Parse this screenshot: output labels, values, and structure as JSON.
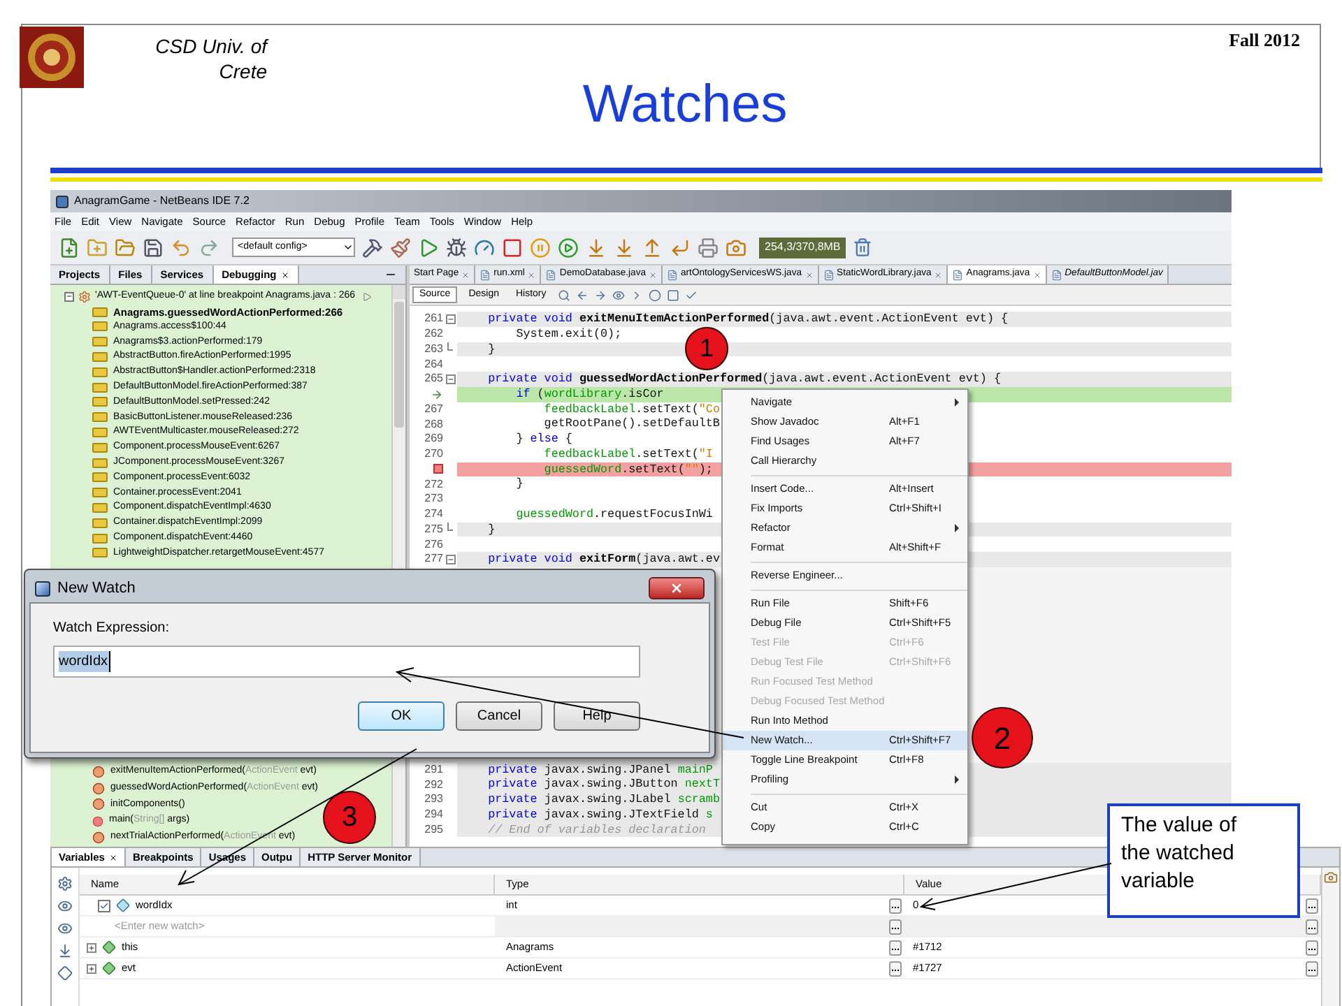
{
  "slide": {
    "institution": "CSD Univ. of Crete",
    "title": "Watches",
    "term": "Fall 2012"
  },
  "window": {
    "title": "AnagramGame - NetBeans IDE 7.2"
  },
  "menu_bar": [
    "File",
    "Edit",
    "View",
    "Navigate",
    "Source",
    "Refactor",
    "Run",
    "Debug",
    "Profile",
    "Team",
    "Tools",
    "Window",
    "Help"
  ],
  "toolbar": {
    "config": "<default config>",
    "memory": "254,3/370,8MB"
  },
  "left_panel": {
    "tabs": [
      {
        "label": "Projects",
        "selected": false
      },
      {
        "label": "Files",
        "selected": false
      },
      {
        "label": "Services",
        "selected": false
      },
      {
        "label": "Debugging",
        "selected": true
      }
    ],
    "thread": {
      "label": "'AWT-EventQueue-0' at line breakpoint Anagrams.java : 266",
      "expanded": true
    },
    "frames": [
      {
        "label": "Anagrams.guessedWordActionPerformed:266",
        "current": true
      },
      {
        "label": "Anagrams.access$100:44",
        "current": false
      },
      {
        "label": "Anagrams$3.actionPerformed:179",
        "current": false
      },
      {
        "label": "AbstractButton.fireActionPerformed:1995",
        "current": false
      },
      {
        "label": "AbstractButton$Handler.actionPerformed:2318",
        "current": false
      },
      {
        "label": "DefaultButtonModel.fireActionPerformed:387",
        "current": false
      },
      {
        "label": "DefaultButtonModel.setPressed:242",
        "current": false
      },
      {
        "label": "BasicButtonListener.mouseReleased:236",
        "current": false
      },
      {
        "label": "AWTEventMulticaster.mouseReleased:272",
        "current": false
      },
      {
        "label": "Component.processMouseEvent:6267",
        "current": false
      },
      {
        "label": "JComponent.processMouseEvent:3267",
        "current": false
      },
      {
        "label": "Component.processEvent:6032",
        "current": false
      },
      {
        "label": "Container.processEvent:2041",
        "current": false
      },
      {
        "label": "Component.dispatchEventImpl:4630",
        "current": false
      },
      {
        "label": "Container.dispatchEventImpl:2099",
        "current": false
      },
      {
        "label": "Component.dispatchEvent:4460",
        "current": false
      },
      {
        "label": "LightweightDispatcher.retargetMouseEvent:4577",
        "current": false
      }
    ],
    "members": [
      {
        "kind": "method",
        "parts": [
          {
            "text": "exitMenuItemActionPerformed("
          },
          {
            "text": "ActionEvent",
            "kind": "type"
          },
          {
            "text": " evt)"
          }
        ]
      },
      {
        "kind": "method",
        "parts": [
          {
            "text": "guessedWordActionPerformed("
          },
          {
            "text": "ActionEvent",
            "kind": "type"
          },
          {
            "text": " evt)"
          }
        ]
      },
      {
        "kind": "method",
        "parts": [
          {
            "text": "initComponents()"
          }
        ]
      },
      {
        "kind": "static",
        "parts": [
          {
            "text": "main("
          },
          {
            "text": "String[]",
            "kind": "type"
          },
          {
            "text": " args)"
          }
        ]
      },
      {
        "kind": "method",
        "parts": [
          {
            "text": "nextTrialActionPerformed("
          },
          {
            "text": "ActionEvent",
            "kind": "type"
          },
          {
            "text": " evt)"
          }
        ]
      }
    ]
  },
  "editor": {
    "tabs": [
      {
        "label": "Start Page",
        "selected": false,
        "italic": false
      },
      {
        "label": "run.xml",
        "selected": false,
        "italic": false
      },
      {
        "label": "DemoDatabase.java",
        "selected": false,
        "italic": false
      },
      {
        "label": "artOntologyServicesWS.java",
        "selected": false,
        "italic": false
      },
      {
        "label": "StaticWordLibrary.java",
        "selected": false,
        "italic": false
      },
      {
        "label": "Anagrams.java",
        "selected": true,
        "italic": false
      },
      {
        "label": "DefaultButtonModel.jav",
        "selected": false,
        "italic": true
      }
    ],
    "view_tabs": [
      {
        "label": "Source",
        "selected": true
      },
      {
        "label": "Design",
        "selected": false
      },
      {
        "label": "History",
        "selected": false
      }
    ],
    "lines_top": [
      {
        "number": "261",
        "kind": "guarded",
        "fold_start": true,
        "fold_end": false,
        "tokens": [
          {
            "text": "    private void ",
            "kind": "keyword"
          },
          {
            "text": "exitMenuItemActionPerformed",
            "kind": "method"
          },
          {
            "text": "(java.awt.event.ActionEvent evt) {"
          }
        ]
      },
      {
        "number": "262",
        "kind": "plain",
        "fold_start": false,
        "fold_end": false,
        "tokens": [
          {
            "text": "        System.exit(0);"
          }
        ]
      },
      {
        "number": "263",
        "kind": "guarded",
        "fold_start": false,
        "fold_end": true,
        "tokens": [
          {
            "text": "    }"
          }
        ]
      },
      {
        "number": "264",
        "kind": "plain",
        "fold_start": false,
        "fold_end": false
      },
      {
        "number": "265",
        "kind": "guarded",
        "fold_start": true,
        "fold_end": false,
        "tokens": [
          {
            "text": "    private void ",
            "kind": "keyword"
          },
          {
            "text": "guessedWordActionPerformed",
            "kind": "method"
          },
          {
            "text": "(java.awt.event.ActionEvent evt) {"
          }
        ]
      },
      {
        "kind": "current",
        "fold_start": false,
        "fold_end": false,
        "tokens": [
          {
            "text": "        if ",
            "kind": "keyword"
          },
          {
            "text": "("
          },
          {
            "text": "wordLibrary",
            "kind": "field"
          },
          {
            "text": ".isCor"
          }
        ]
      },
      {
        "number": "267",
        "kind": "plain",
        "fold_start": false,
        "fold_end": false,
        "tokens": [
          {
            "text": "            feedbackLabel",
            "kind": "field"
          },
          {
            "text": ".setText("
          },
          {
            "text": "\"Co",
            "kind": "string"
          }
        ]
      },
      {
        "number": "268",
        "kind": "plain",
        "fold_start": false,
        "fold_end": false,
        "tokens": [
          {
            "text": "            getRootPane().setDefaultB"
          }
        ]
      },
      {
        "number": "269",
        "kind": "plain",
        "fold_start": false,
        "fold_end": false,
        "tokens": [
          {
            "text": "        } "
          },
          {
            "text": "else",
            "kind": "keyword"
          },
          {
            "text": " {"
          }
        ]
      },
      {
        "number": "270",
        "kind": "plain",
        "fold_start": false,
        "fold_end": false,
        "tokens": [
          {
            "text": "            feedbackLabel",
            "kind": "field"
          },
          {
            "text": ".setText("
          },
          {
            "text": "\"I",
            "kind": "string"
          }
        ]
      },
      {
        "kind": "breakpoint",
        "fold_start": false,
        "fold_end": false,
        "tokens": [
          {
            "text": "            guessedWord",
            "kind": "field"
          },
          {
            "text": ".setText("
          },
          {
            "text": "\"\"",
            "kind": "string"
          },
          {
            "text": ");"
          }
        ]
      },
      {
        "number": "272",
        "kind": "plain",
        "fold_start": false,
        "fold_end": false,
        "tokens": [
          {
            "text": "        }"
          }
        ]
      },
      {
        "number": "273",
        "kind": "plain",
        "fold_start": false,
        "fold_end": false
      },
      {
        "number": "274",
        "kind": "plain",
        "fold_start": false,
        "fold_end": false,
        "tokens": [
          {
            "text": "        guessedWord",
            "kind": "field"
          },
          {
            "text": ".requestFocusInWi"
          }
        ]
      },
      {
        "number": "275",
        "kind": "guarded",
        "fold_start": false,
        "fold_end": true,
        "tokens": [
          {
            "text": "    }"
          }
        ]
      },
      {
        "number": "276",
        "kind": "plain",
        "fold_start": false,
        "fold_end": false
      },
      {
        "number": "277",
        "kind": "guarded",
        "fold_start": true,
        "fold_end": false,
        "tokens": [
          {
            "text": "    private void ",
            "kind": "keyword"
          },
          {
            "text": "exitForm",
            "kind": "method"
          },
          {
            "text": "(java.awt.ev"
          }
        ]
      }
    ],
    "lines_bottom": [
      {
        "number": "291",
        "kind": "guarded",
        "fold_start": false,
        "fold_end": false,
        "tokens": [
          {
            "text": "    private ",
            "kind": "keyword"
          },
          {
            "text": "javax.swing.JPanel "
          },
          {
            "text": "mainP",
            "kind": "field"
          }
        ]
      },
      {
        "number": "292",
        "kind": "guarded",
        "fold_start": false,
        "fold_end": false,
        "tokens": [
          {
            "text": "    private ",
            "kind": "keyword"
          },
          {
            "text": "javax.swing.JButton "
          },
          {
            "text": "nextT",
            "kind": "field"
          }
        ]
      },
      {
        "number": "293",
        "kind": "guarded",
        "fold_start": false,
        "fold_end": false,
        "tokens": [
          {
            "text": "    private ",
            "kind": "keyword"
          },
          {
            "text": "javax.swing.JLabel "
          },
          {
            "text": "scramb",
            "kind": "field"
          }
        ]
      },
      {
        "number": "294",
        "kind": "guarded",
        "fold_start": false,
        "fold_end": false,
        "tokens": [
          {
            "text": "    private ",
            "kind": "keyword"
          },
          {
            "text": "javax.swing.JTextField "
          },
          {
            "text": "s",
            "kind": "field"
          }
        ]
      },
      {
        "number": "295",
        "kind": "guarded",
        "fold_start": false,
        "fold_end": false,
        "tokens": [
          {
            "text": "    // End of variables declaration",
            "kind": "comment"
          }
        ]
      }
    ]
  },
  "context_menu": [
    {
      "kind": "item",
      "label": "Navigate",
      "submenu": true,
      "disabled": false,
      "selected": false
    },
    {
      "kind": "item",
      "label": "Show Javadoc",
      "shortcut": "Alt+F1",
      "submenu": false,
      "disabled": false,
      "selected": false
    },
    {
      "kind": "item",
      "label": "Find Usages",
      "shortcut": "Alt+F7",
      "submenu": false,
      "disabled": false,
      "selected": false
    },
    {
      "kind": "item",
      "label": "Call Hierarchy",
      "submenu": false,
      "disabled": false,
      "selected": false
    },
    {
      "kind": "separator"
    },
    {
      "kind": "item",
      "label": "Insert Code...",
      "shortcut": "Alt+Insert",
      "submenu": false,
      "disabled": false,
      "selected": false
    },
    {
      "kind": "item",
      "label": "Fix Imports",
      "shortcut": "Ctrl+Shift+I",
      "submenu": false,
      "disabled": false,
      "selected": false
    },
    {
      "kind": "item",
      "label": "Refactor",
      "submenu": true,
      "disabled": false,
      "selected": false
    },
    {
      "kind": "item",
      "label": "Format",
      "shortcut": "Alt+Shift+F",
      "submenu": false,
      "disabled": false,
      "selected": false
    },
    {
      "kind": "separator"
    },
    {
      "kind": "item",
      "label": "Reverse Engineer...",
      "submenu": false,
      "disabled": false,
      "selected": false
    },
    {
      "kind": "separator"
    },
    {
      "kind": "item",
      "label": "Run File",
      "shortcut": "Shift+F6",
      "submenu": false,
      "disabled": false,
      "selected": false
    },
    {
      "kind": "item",
      "label": "Debug File",
      "shortcut": "Ctrl+Shift+F5",
      "submenu": false,
      "disabled": false,
      "selected": false
    },
    {
      "kind": "item",
      "label": "Test File",
      "shortcut": "Ctrl+F6",
      "submenu": false,
      "disabled": true,
      "selected": false
    },
    {
      "kind": "item",
      "label": "Debug Test File",
      "shortcut": "Ctrl+Shift+F6",
      "submenu": false,
      "disabled": true,
      "selected": false
    },
    {
      "kind": "item",
      "label": "Run Focused Test Method",
      "submenu": false,
      "disabled": true,
      "selected": false
    },
    {
      "kind": "item",
      "label": "Debug Focused Test Method",
      "submenu": false,
      "disabled": true,
      "selected": false
    },
    {
      "kind": "item",
      "label": "Run Into Method",
      "submenu": false,
      "disabled": false,
      "selected": false
    },
    {
      "kind": "item",
      "label": "New Watch...",
      "shortcut": "Ctrl+Shift+F7",
      "submenu": false,
      "disabled": false,
      "selected": true
    },
    {
      "kind": "item",
      "label": "Toggle Line Breakpoint",
      "shortcut": "Ctrl+F8",
      "submenu": false,
      "disabled": false,
      "selected": false
    },
    {
      "kind": "item",
      "label": "Profiling",
      "submenu": true,
      "disabled": false,
      "selected": false
    },
    {
      "kind": "separator"
    },
    {
      "kind": "item",
      "label": "Cut",
      "shortcut": "Ctrl+X",
      "submenu": false,
      "disabled": false,
      "selected": false
    },
    {
      "kind": "item",
      "label": "Copy",
      "shortcut": "Ctrl+C",
      "submenu": false,
      "disabled": false,
      "selected": false
    }
  ],
  "dialog": {
    "title": "New Watch",
    "label": "Watch Expression:",
    "value": "wordIdx",
    "buttons": [
      {
        "label": "OK",
        "default": true
      },
      {
        "label": "Cancel",
        "default": false
      },
      {
        "label": "Help",
        "default": false
      }
    ]
  },
  "variables_panel": {
    "tabs": [
      {
        "label": "Variables",
        "selected": true
      },
      {
        "label": "Breakpoints",
        "selected": false
      },
      {
        "label": "Usages",
        "selected": false
      },
      {
        "label": "Outpu",
        "selected": false
      },
      {
        "label": "HTTP Server Monitor",
        "selected": false
      }
    ],
    "columns": [
      "Name",
      "Type",
      "Value"
    ],
    "rows": [
      {
        "kind": "watch",
        "name": "wordIdx",
        "checked": true,
        "type": "int",
        "value": "0"
      },
      {
        "kind": "new_watch",
        "name": "<Enter new watch>"
      },
      {
        "kind": "variable",
        "name": "this",
        "expanded": false,
        "type": "Anagrams",
        "value": "#1712"
      },
      {
        "kind": "variable",
        "name": "evt",
        "expanded": false,
        "type": "ActionEvent",
        "value": "#1727"
      }
    ]
  },
  "callouts": [
    {
      "number": "1"
    },
    {
      "number": "2"
    },
    {
      "number": "3"
    }
  ],
  "note": "The value of the watched variable"
}
